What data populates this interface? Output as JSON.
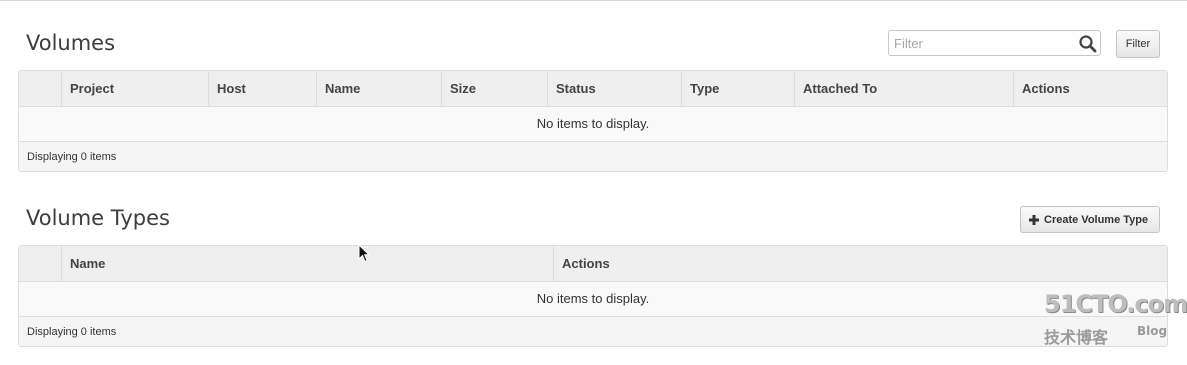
{
  "volumes": {
    "title": "Volumes",
    "filter_placeholder": "Filter",
    "filter_value": "",
    "filter_button_label": "Filter",
    "columns": [
      "",
      "Project",
      "Host",
      "Name",
      "Size",
      "Status",
      "Type",
      "Attached To",
      "Actions"
    ],
    "empty_message": "No items to display.",
    "footer_text": "Displaying 0 items"
  },
  "volume_types": {
    "title": "Volume Types",
    "create_button_label": "Create Volume Type",
    "columns": [
      "",
      "Name",
      "Actions"
    ],
    "empty_message": "No items to display.",
    "footer_text": "Displaying 0 items"
  },
  "watermark": {
    "logo": "51CTO.com",
    "sub": "技术博客",
    "blog": "Blog"
  },
  "icons": {
    "search": "search-icon",
    "plus": "plus-icon",
    "cursor": "mouse-cursor-icon"
  }
}
